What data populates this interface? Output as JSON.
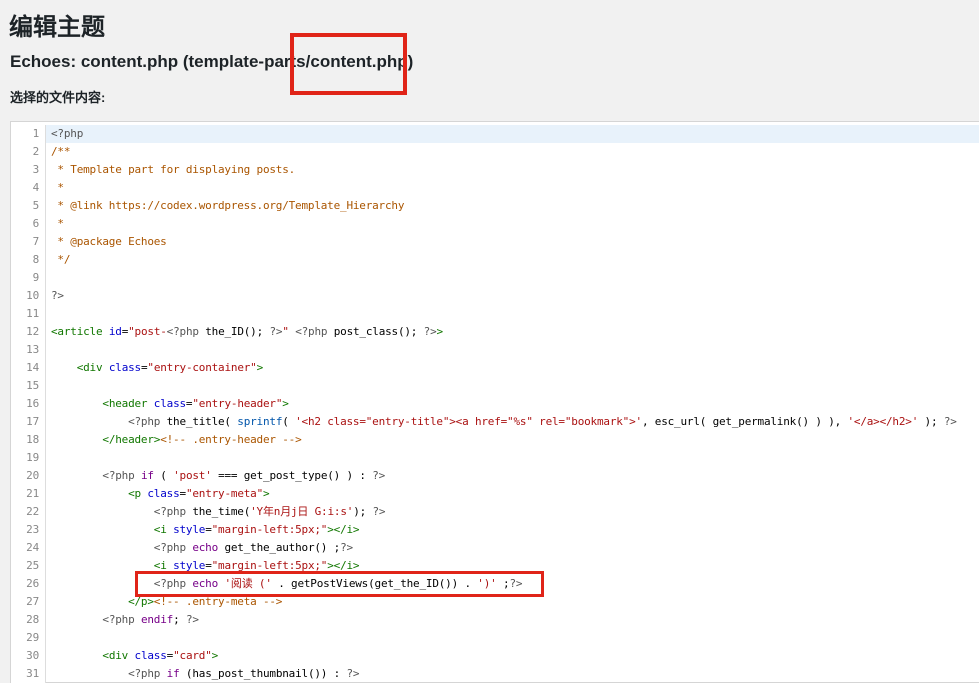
{
  "page": {
    "title": "编辑主题",
    "file_heading": "Echoes: content.php (template-parts/content.php)",
    "content_label": "选择的文件内容:"
  },
  "annotations": {
    "color": "#e02418",
    "boxes": [
      {
        "name": "filename-highlight",
        "target_text": "/content.php)"
      },
      {
        "name": "code-line-highlight",
        "target_line": 26
      }
    ]
  },
  "editor": {
    "active_line": 1,
    "token_colors": {
      "m": "#555555",
      "k": "#770088",
      "s": "#aa1111",
      "c": "#aa5500",
      "t": "#117700",
      "a": "#0000cc",
      "b": "#0055aa",
      "p": "#000000"
    },
    "lines": [
      [
        [
          "m",
          "<?php"
        ]
      ],
      [
        [
          "c",
          "/**"
        ]
      ],
      [
        [
          "c",
          " * Template part for displaying posts."
        ]
      ],
      [
        [
          "c",
          " *"
        ]
      ],
      [
        [
          "c",
          " * @link https://codex.wordpress.org/Template_Hierarchy"
        ]
      ],
      [
        [
          "c",
          " *"
        ]
      ],
      [
        [
          "c",
          " * @package Echoes"
        ]
      ],
      [
        [
          "c",
          " */"
        ]
      ],
      [],
      [
        [
          "m",
          "?>"
        ]
      ],
      [],
      [
        [
          "t",
          "<article"
        ],
        [
          "p",
          " "
        ],
        [
          "a",
          "id"
        ],
        [
          "p",
          "="
        ],
        [
          "s",
          "\"post-"
        ],
        [
          "m",
          "<?php"
        ],
        [
          "p",
          " the_ID(); "
        ],
        [
          "m",
          "?>"
        ],
        [
          "s",
          "\""
        ],
        [
          "p",
          " "
        ],
        [
          "m",
          "<?php"
        ],
        [
          "p",
          " post_class(); "
        ],
        [
          "m",
          "?>"
        ],
        [
          "t",
          ">"
        ]
      ],
      [],
      [
        [
          "p",
          "    "
        ],
        [
          "t",
          "<div"
        ],
        [
          "p",
          " "
        ],
        [
          "a",
          "class"
        ],
        [
          "p",
          "="
        ],
        [
          "s",
          "\"entry-container\""
        ],
        [
          "t",
          ">"
        ]
      ],
      [],
      [
        [
          "p",
          "        "
        ],
        [
          "t",
          "<header"
        ],
        [
          "p",
          " "
        ],
        [
          "a",
          "class"
        ],
        [
          "p",
          "="
        ],
        [
          "s",
          "\"entry-header\""
        ],
        [
          "t",
          ">"
        ]
      ],
      [
        [
          "p",
          "            "
        ],
        [
          "m",
          "<?php"
        ],
        [
          "p",
          " the_title( "
        ],
        [
          "b",
          "sprintf"
        ],
        [
          "p",
          "( "
        ],
        [
          "s",
          "'<h2 class=\"entry-title\"><a href=\"%s\" rel=\"bookmark\">'"
        ],
        [
          "p",
          ", esc_url( get_permalink() ) ), "
        ],
        [
          "s",
          "'</a></h2>'"
        ],
        [
          "p",
          " ); "
        ],
        [
          "m",
          "?>"
        ]
      ],
      [
        [
          "p",
          "        "
        ],
        [
          "t",
          "</header>"
        ],
        [
          "c",
          "<!-- .entry-header -->"
        ]
      ],
      [],
      [
        [
          "p",
          "        "
        ],
        [
          "m",
          "<?php"
        ],
        [
          "p",
          " "
        ],
        [
          "k",
          "if"
        ],
        [
          "p",
          " ( "
        ],
        [
          "s",
          "'post'"
        ],
        [
          "p",
          " === get_post_type() ) : "
        ],
        [
          "m",
          "?>"
        ]
      ],
      [
        [
          "p",
          "            "
        ],
        [
          "t",
          "<p"
        ],
        [
          "p",
          " "
        ],
        [
          "a",
          "class"
        ],
        [
          "p",
          "="
        ],
        [
          "s",
          "\"entry-meta\""
        ],
        [
          "t",
          ">"
        ]
      ],
      [
        [
          "p",
          "                "
        ],
        [
          "m",
          "<?php"
        ],
        [
          "p",
          " the_time("
        ],
        [
          "s",
          "'Y年n月j日 G:i:s'"
        ],
        [
          "p",
          "); "
        ],
        [
          "m",
          "?>"
        ]
      ],
      [
        [
          "p",
          "                "
        ],
        [
          "t",
          "<i"
        ],
        [
          "p",
          " "
        ],
        [
          "a",
          "style"
        ],
        [
          "p",
          "="
        ],
        [
          "s",
          "\"margin-left:5px;\""
        ],
        [
          "t",
          "></i>"
        ]
      ],
      [
        [
          "p",
          "                "
        ],
        [
          "m",
          "<?php"
        ],
        [
          "p",
          " "
        ],
        [
          "k",
          "echo"
        ],
        [
          "p",
          " get_the_author() ;"
        ],
        [
          "m",
          "?>"
        ]
      ],
      [
        [
          "p",
          "                "
        ],
        [
          "t",
          "<i"
        ],
        [
          "p",
          " "
        ],
        [
          "a",
          "style"
        ],
        [
          "p",
          "="
        ],
        [
          "s",
          "\"margin-left:5px;\""
        ],
        [
          "t",
          "></i>"
        ]
      ],
      [
        [
          "p",
          "                "
        ],
        [
          "m",
          "<?php"
        ],
        [
          "p",
          " "
        ],
        [
          "k",
          "echo"
        ],
        [
          "p",
          " "
        ],
        [
          "s",
          "'阅读 ('"
        ],
        [
          "p",
          " . getPostViews(get_the_ID()) . "
        ],
        [
          "s",
          "')'"
        ],
        [
          "p",
          " ;"
        ],
        [
          "m",
          "?>"
        ]
      ],
      [
        [
          "p",
          "            "
        ],
        [
          "t",
          "</p>"
        ],
        [
          "c",
          "<!-- .entry-meta -->"
        ]
      ],
      [
        [
          "p",
          "        "
        ],
        [
          "m",
          "<?php"
        ],
        [
          "p",
          " "
        ],
        [
          "k",
          "endif"
        ],
        [
          "p",
          "; "
        ],
        [
          "m",
          "?>"
        ]
      ],
      [],
      [
        [
          "p",
          "        "
        ],
        [
          "t",
          "<div"
        ],
        [
          "p",
          " "
        ],
        [
          "a",
          "class"
        ],
        [
          "p",
          "="
        ],
        [
          "s",
          "\"card\""
        ],
        [
          "t",
          ">"
        ]
      ],
      [
        [
          "p",
          "            "
        ],
        [
          "m",
          "<?php"
        ],
        [
          "p",
          " "
        ],
        [
          "k",
          "if"
        ],
        [
          "p",
          " (has_post_thumbnail()) : "
        ],
        [
          "m",
          "?>"
        ]
      ]
    ]
  }
}
